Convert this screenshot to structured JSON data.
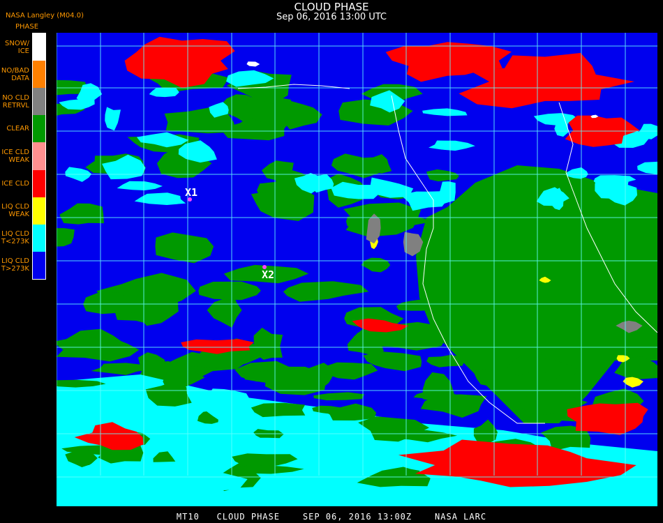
{
  "header": {
    "title": "CLOUD PHASE",
    "subtitle": "Sep 06, 2016 13:00 UTC",
    "agency": "NASA Langley (M04.0)"
  },
  "legend": {
    "title": "PHASE",
    "items": [
      {
        "label": "SNOW/\nICE",
        "color": "#ffffff"
      },
      {
        "label": "NO/BAD\nDATA",
        "color": "#ff8000"
      },
      {
        "label": "NO CLD\nRETRVL",
        "color": "#808080"
      },
      {
        "label": "CLEAR",
        "color": "#009900"
      },
      {
        "label": "ICE CLD\nWEAK",
        "color": "#ff9090"
      },
      {
        "label": "ICE CLD",
        "color": "#ff0000"
      },
      {
        "label": "LIQ CLD\nWEAK",
        "color": "#ffff00"
      },
      {
        "label": "LIQ CLD\nT<273K",
        "color": "#00ffff"
      },
      {
        "label": "LIQ CLD\nT>273K",
        "color": "#0000ee"
      }
    ]
  },
  "markers": [
    {
      "label": "X1"
    },
    {
      "label": "X2"
    }
  ],
  "footer": "MT10   CLOUD PHASE    SEP 06, 2016 13:00Z    NASA LARC"
}
